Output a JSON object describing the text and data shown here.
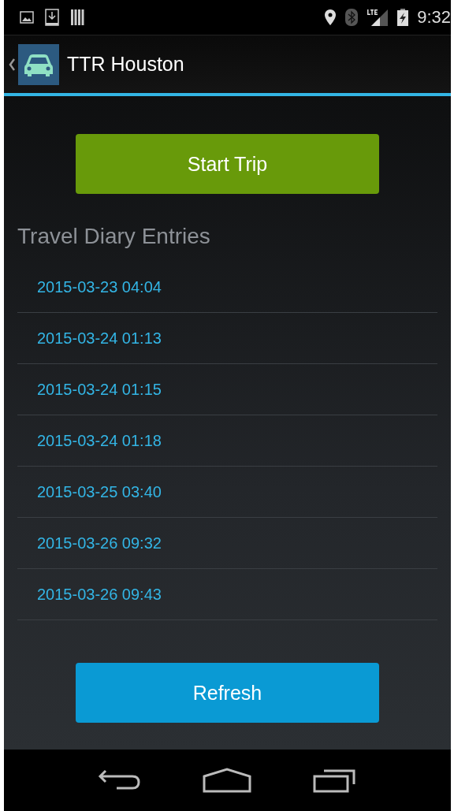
{
  "status_bar": {
    "time": "9:32"
  },
  "action_bar": {
    "title": "TTR Houston"
  },
  "start_button": {
    "label": "Start Trip"
  },
  "entries_heading": "Travel Diary Entries",
  "entries": [
    {
      "label": "2015-03-23 04:04"
    },
    {
      "label": "2015-03-24 01:13"
    },
    {
      "label": "2015-03-24 01:15"
    },
    {
      "label": "2015-03-24 01:18"
    },
    {
      "label": "2015-03-25 03:40"
    },
    {
      "label": "2015-03-26 09:32"
    },
    {
      "label": "2015-03-26 09:43"
    }
  ],
  "refresh_button": {
    "label": "Refresh"
  }
}
